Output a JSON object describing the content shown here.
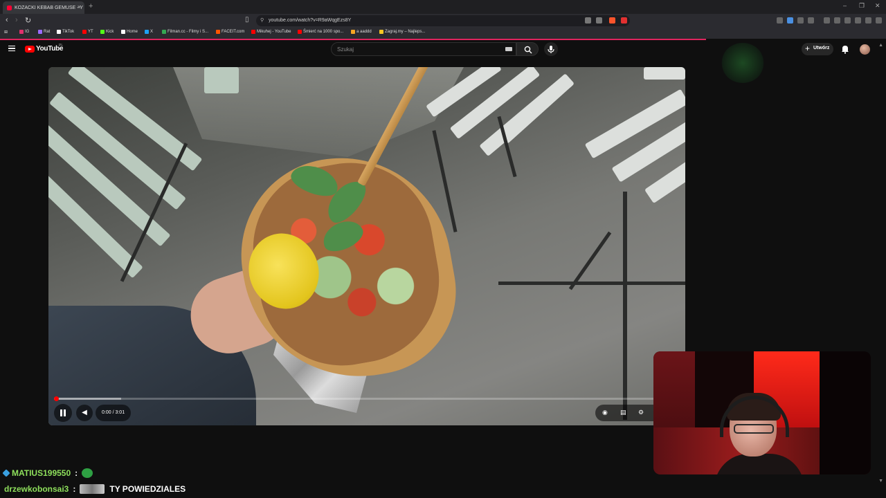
{
  "browser": {
    "tab_title": "KOZACKI KEBAB GEMUSE - Y",
    "url": "youtube.com/watch?v=R9aWqgEzs8Y",
    "bookmarks": [
      {
        "label": "IG",
        "color": "#e1306c"
      },
      {
        "label": "Rat",
        "color": "#9b6bff"
      },
      {
        "label": "TikTok",
        "color": "#ffffff"
      },
      {
        "label": "YT",
        "color": "#ff0000"
      },
      {
        "label": "Kick",
        "color": "#53fc18"
      },
      {
        "label": "Home",
        "color": "#ffffff"
      },
      {
        "label": "X",
        "color": "#1da1f2"
      },
      {
        "label": "Filman.cc - Filmy i S...",
        "color": "#34a853"
      },
      {
        "label": "FACEIT.com",
        "color": "#ff5500"
      },
      {
        "label": "Mikuhej - YouTube",
        "color": "#ff0000"
      },
      {
        "label": "Śmierć na 1000 spo...",
        "color": "#ff0000"
      },
      {
        "label": "a aaddd",
        "color": "#f5a623"
      },
      {
        "label": "Zagraj.my – Najleps...",
        "color": "#f5c623"
      }
    ]
  },
  "youtube": {
    "logo_text": "YouTube",
    "country_code": "PL",
    "search_placeholder": "Szukaj",
    "create_label": "Utwórz"
  },
  "player": {
    "time": "0:00 / 3:01",
    "progress_fraction": 0.0,
    "buffered_fraction": 0.11
  },
  "chat": [
    {
      "user": "MATIUS199550",
      "user_color": "#8fe05c",
      "sep": ":",
      "message": ""
    },
    {
      "user": "drzewkobonsai3",
      "user_color": "#8fe05c",
      "sep": ":",
      "message": "TY POWIEDZIALES"
    }
  ]
}
